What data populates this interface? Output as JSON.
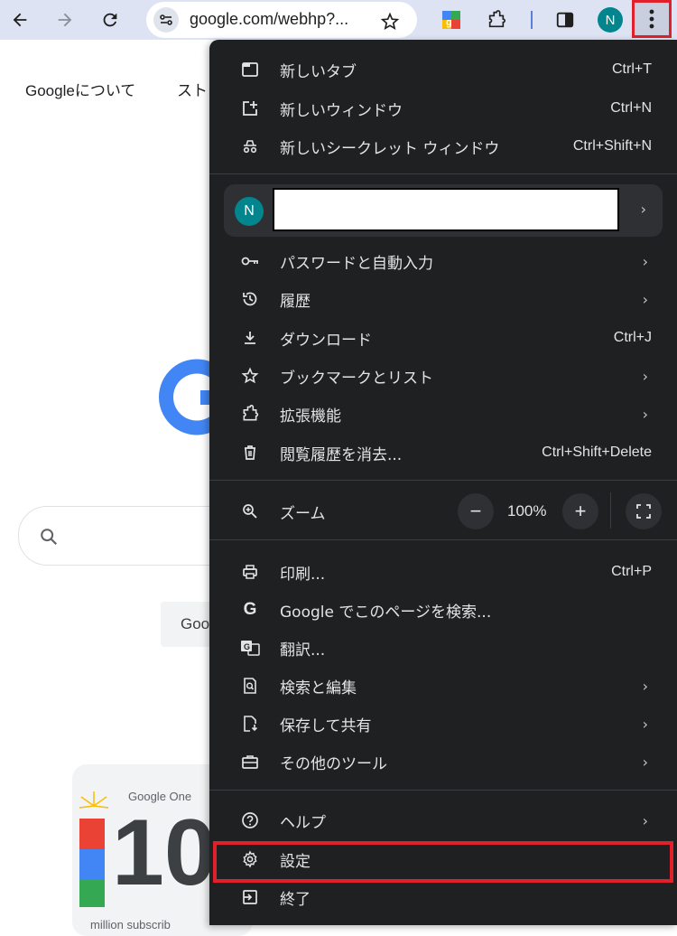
{
  "browser": {
    "url": "google.com/webhp?...",
    "profile_initial": "N"
  },
  "page": {
    "links": [
      "Googleについて",
      "スト"
    ],
    "lucky_partial": "Goo",
    "promo_brand": "Google One",
    "promo_digits": "10",
    "promo_sub": "million subscrib"
  },
  "menu": {
    "items_top": [
      {
        "label": "新しいタブ",
        "shortcut": "Ctrl+T",
        "icon": "new-tab-icon"
      },
      {
        "label": "新しいウィンドウ",
        "shortcut": "Ctrl+N",
        "icon": "new-window-icon"
      },
      {
        "label": "新しいシークレット ウィンドウ",
        "shortcut": "Ctrl+Shift+N",
        "icon": "incognito-icon"
      }
    ],
    "profile": {
      "initial": "N"
    },
    "items_mid": [
      {
        "label": "パスワードと自動入力",
        "icon": "key-icon",
        "submenu": true
      },
      {
        "label": "履歴",
        "icon": "history-icon",
        "submenu": true
      },
      {
        "label": "ダウンロード",
        "shortcut": "Ctrl+J",
        "icon": "download-icon"
      },
      {
        "label": "ブックマークとリスト",
        "icon": "star-icon",
        "submenu": true
      },
      {
        "label": "拡張機能",
        "icon": "extension-icon",
        "submenu": true
      },
      {
        "label": "閲覧履歴を消去...",
        "shortcut": "Ctrl+Shift+Delete",
        "icon": "trash-icon"
      }
    ],
    "zoom": {
      "label": "ズーム",
      "value": "100%",
      "minus": "−",
      "plus": "+"
    },
    "items_tools": [
      {
        "label": "印刷...",
        "shortcut": "Ctrl+P",
        "icon": "print-icon"
      },
      {
        "label": "Google でこのページを検索...",
        "icon": "google-g-icon"
      },
      {
        "label": "翻訳...",
        "icon": "translate-icon"
      },
      {
        "label": "検索と編集",
        "icon": "find-icon",
        "submenu": true
      },
      {
        "label": "保存して共有",
        "icon": "save-share-icon",
        "submenu": true
      },
      {
        "label": "その他のツール",
        "icon": "toolbox-icon",
        "submenu": true
      }
    ],
    "items_bottom": [
      {
        "label": "ヘルプ",
        "icon": "help-icon",
        "submenu": true
      },
      {
        "label": "設定",
        "icon": "gear-icon"
      },
      {
        "label": "終了",
        "icon": "exit-icon"
      }
    ]
  },
  "colors": {
    "highlight": "#e0202a",
    "menu_bg": "#1f2022",
    "toolbar_bg": "#dee3f3"
  }
}
